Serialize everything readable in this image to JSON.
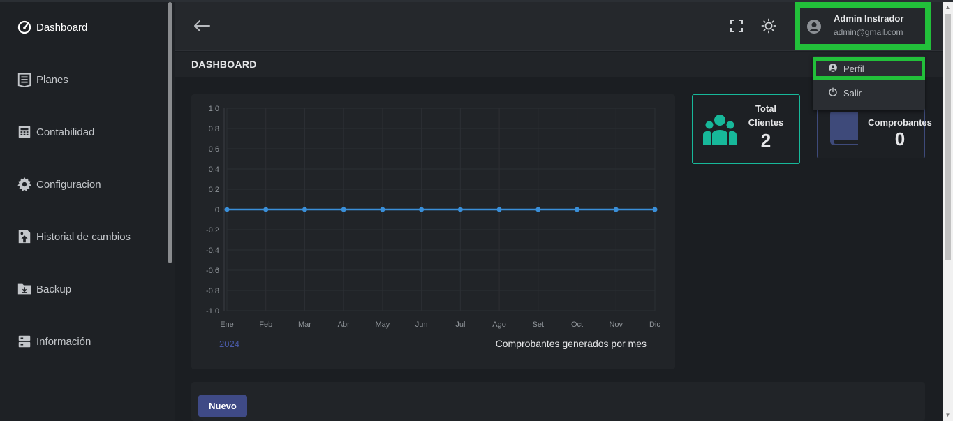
{
  "sidebar": {
    "items": [
      {
        "label": "Dashboard",
        "icon": "speedometer-icon",
        "active": true
      },
      {
        "label": "Planes",
        "icon": "list-document-icon"
      },
      {
        "label": "Contabilidad",
        "icon": "calculator-icon"
      },
      {
        "label": "Configuracion",
        "icon": "gear-icon"
      },
      {
        "label": "Historial de cambios",
        "icon": "history-upload-icon"
      },
      {
        "label": "Backup",
        "icon": "folder-download-icon"
      },
      {
        "label": "Información",
        "icon": "server-icon"
      }
    ]
  },
  "header": {
    "back_icon": "arrow-left-icon",
    "fullscreen_icon": "fullscreen-icon",
    "theme_icon": "sun-icon",
    "user": {
      "name": "Admin Instrador",
      "email": "admin@gmail.com",
      "icon": "user-circle-icon"
    }
  },
  "dropdown": {
    "items": [
      {
        "label": "Perfil",
        "icon": "user-circle-icon"
      },
      {
        "label": "Salir",
        "icon": "power-icon"
      }
    ]
  },
  "page": {
    "title": "DASHBOARD"
  },
  "stats": [
    {
      "label_line1": "Total",
      "label_line2": "Clientes",
      "value": "2",
      "icon": "users-icon",
      "color": "#17b89a"
    },
    {
      "label_line1": "Comprobantes",
      "label_line2": "",
      "value": "0",
      "icon": "book-icon",
      "color": "#3e4a7a"
    }
  ],
  "chart_data": {
    "type": "line",
    "categories": [
      "Ene",
      "Feb",
      "Mar",
      "Abr",
      "May",
      "Jun",
      "Jul",
      "Ago",
      "Set",
      "Oct",
      "Nov",
      "Dic"
    ],
    "series": [
      {
        "name": "2024",
        "values": [
          0,
          0,
          0,
          0,
          0,
          0,
          0,
          0,
          0,
          0,
          0,
          0
        ]
      }
    ],
    "yticks": [
      "1.0",
      "0.8",
      "0.6",
      "0.4",
      "0.2",
      "0",
      "-0.2",
      "-0.4",
      "-0.6",
      "-0.8",
      "-1.0"
    ],
    "ylim": [
      -1.0,
      1.0
    ],
    "legend": "2024",
    "caption": "Comprobantes generados por mes",
    "grid": true,
    "line_color": "#3a8fd9",
    "legend_color": "#4a5aa8"
  },
  "actions": {
    "new_label": "Nuevo"
  }
}
